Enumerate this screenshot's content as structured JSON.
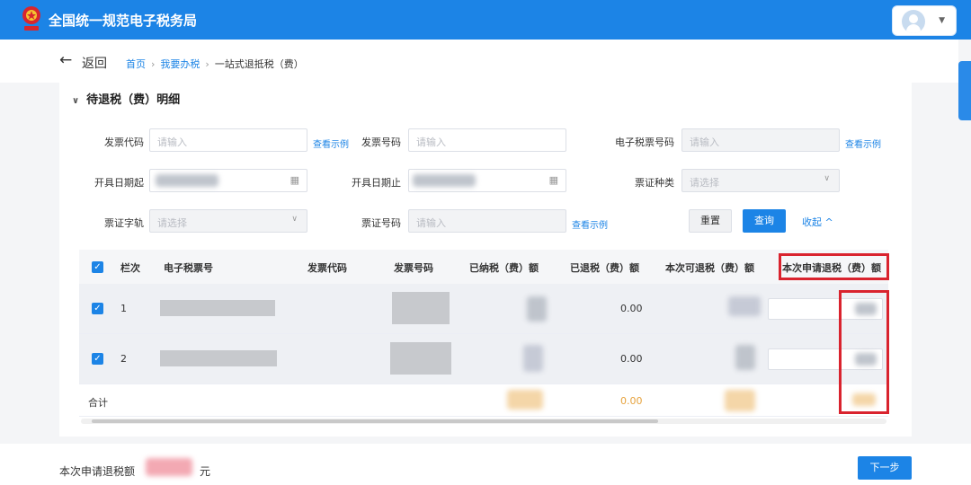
{
  "header": {
    "title": "全国统一规范电子税务局",
    "brand_color": "#1c84e6"
  },
  "nav": {
    "back_label": "返回",
    "breadcrumb": [
      "首页",
      "我要办税",
      "一站式退抵税（费）"
    ]
  },
  "section": {
    "title": "待退税（费）明细"
  },
  "filters": {
    "invoice_code": {
      "label": "发票代码",
      "placeholder": "请输入",
      "link": "查看示例"
    },
    "invoice_number": {
      "label": "发票号码",
      "placeholder": "请输入"
    },
    "e_tax_number": {
      "label": "电子税票号码",
      "placeholder": "请输入",
      "link": "查看示例"
    },
    "issue_date_from": {
      "label": "开具日期起"
    },
    "issue_date_to": {
      "label": "开具日期止"
    },
    "voucher_type": {
      "label": "票证种类",
      "placeholder": "请选择"
    },
    "voucher_prefix": {
      "label": "票证字轨",
      "placeholder": "请选择"
    },
    "voucher_number": {
      "label": "票证号码",
      "placeholder": "请输入",
      "link": "查看示例"
    },
    "reset_label": "重置",
    "query_label": "查询",
    "collapse_label": "收起 ^"
  },
  "table": {
    "columns": [
      "栏次",
      "电子税票号",
      "发票代码",
      "发票号码",
      "已纳税（费）额",
      "已退税（费）额",
      "本次可退税（费）额",
      "本次申请退税（费）额"
    ],
    "rows": [
      {
        "index": "1",
        "refunded": "0.00"
      },
      {
        "index": "2",
        "refunded": "0.00"
      }
    ],
    "total": {
      "label": "合计",
      "refunded": "0.00"
    }
  },
  "footer": {
    "refund_label": "本次申请退税额",
    "unit": "元",
    "next_label": "下一步"
  },
  "colors": {
    "highlight": "#d9232e",
    "total_amount": "#e6a23c"
  }
}
